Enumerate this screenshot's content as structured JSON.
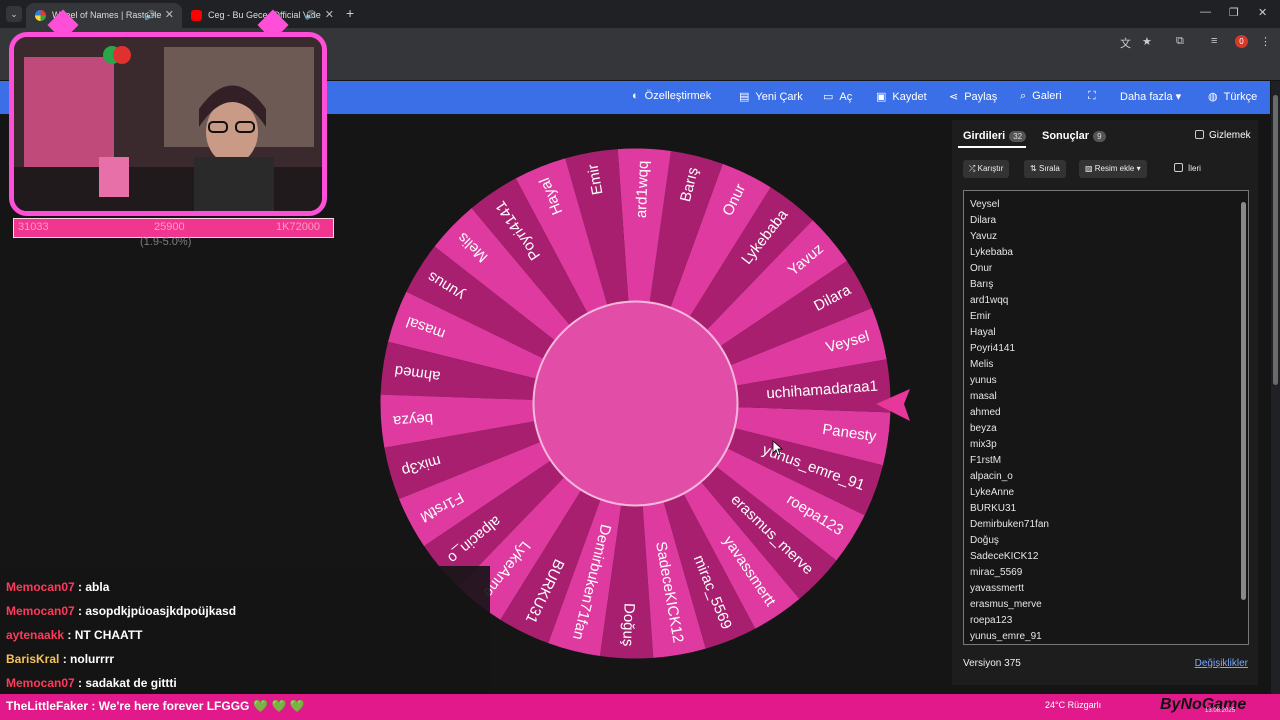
{
  "browser": {
    "tabs": [
      {
        "title": "Wheel of Names | Rastgele",
        "audio": "🔊",
        "close": "✕"
      },
      {
        "title": "Ceg - Bu Gece (Official Vide",
        "audio": "🔊",
        "close": "✕"
      }
    ],
    "new_tab": "+",
    "window_controls": [
      "—",
      "❐",
      "✕"
    ],
    "extension_badge": "0"
  },
  "toolbar": {
    "customize": "Özelleştirmek",
    "new_wheel": "Yeni Çark",
    "open": "Aç",
    "save": "Kaydet",
    "share": "Paylaş",
    "gallery": "Galeri",
    "more": "Daha fazla",
    "language": "Türkçe"
  },
  "wheel": {
    "segments": [
      "Veysel",
      "Dilara",
      "Yavuz",
      "Lykebaba",
      "Onur",
      "Barış",
      "ard1wqq",
      "Emir",
      "Hayal",
      "Poyri4141",
      "Melis",
      "yunus",
      "masal",
      "ahmed",
      "beyza",
      "mix3p",
      "F1rstM",
      "alpacin_o",
      "LykeAnne",
      "BURKU31",
      "Demirbuken71fan",
      "Doğuş",
      "SadeceKICK12",
      "mirac_5569",
      "yavassmertt",
      "erasmus_merve",
      "roepa123",
      "yunus_emre_91",
      "Panesty",
      "uchihamadaraa1"
    ],
    "colors": {
      "light": "#df3a9f",
      "dark": "#a81f6f",
      "center": "#e24ea7",
      "pointer": "#e8379a"
    }
  },
  "panel": {
    "tab_entries": "Girdileri",
    "entries_count": "32",
    "tab_results": "Sonuçlar",
    "results_count": "9",
    "hide_label": "Gizlemek",
    "shuffle": "Karıştır",
    "sort": "Sırala",
    "add_image": "Resim ekle",
    "advanced": "İleri",
    "entries": [
      "Veysel",
      "Dilara",
      "Yavuz",
      "Lykebaba",
      "Onur",
      "Barış",
      "ard1wqq",
      "Emir",
      "Hayal",
      "Poyri4141",
      "Melis",
      "yunus",
      "masal",
      "ahmed",
      "beyza",
      "mix3p",
      "F1rstM",
      "alpacin_o",
      "LykeAnne",
      "BURKU31",
      "Demirbuken71fan",
      "Doğuş",
      "SadeceKICK12",
      "mirac_5569",
      "yavassmertt",
      "erasmus_merve",
      "roepa123",
      "yunus_emre_91"
    ],
    "version": "Versiyon 375",
    "changes": "Değişiklikler"
  },
  "stream": {
    "stat_left": "31033",
    "stat_mid": "25900",
    "stat_right": "1K72000",
    "stat_sub": "(1.9-5.0%)",
    "chat": [
      {
        "user": "Memocan07",
        "text": " : abla",
        "color": "#ff3b5c"
      },
      {
        "user": "Memocan07",
        "text": " : asopdkjpüoasjkdpoüjkasd",
        "color": "#ff3b5c"
      },
      {
        "user": "aytenaakk",
        "text": " : NT CHAATT",
        "color": "#ff3b5c"
      },
      {
        "user": "BarisKral",
        "text": " : nolurrrr",
        "color": "#f5c25b"
      },
      {
        "user": "Memocan07",
        "text": " : sadakat de gittti",
        "color": "#ff3b5c"
      }
    ],
    "ticker": "TheLittleFaker : We're here forever LFGGG",
    "hearts": "💚 💚 💚",
    "weather": "24°C  Rüzgarlı",
    "logo": "ByNoGame",
    "date": "13.08.2025"
  }
}
